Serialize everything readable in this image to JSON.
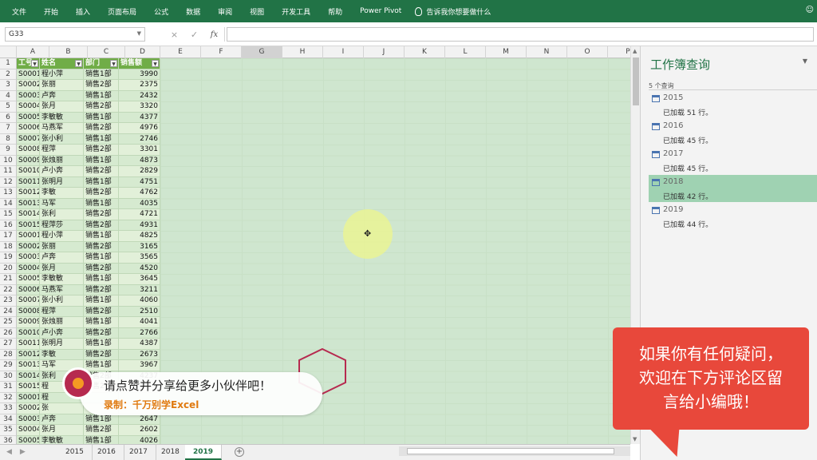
{
  "ribbon": {
    "tabs": [
      "文件",
      "开始",
      "插入",
      "页面布局",
      "公式",
      "数据",
      "审阅",
      "视图",
      "开发工具",
      "帮助",
      "Power Pivot"
    ],
    "tell_me": "告诉我你想要做什么"
  },
  "formula_bar": {
    "name_box": "G33",
    "cancel": "×",
    "enter": "✓",
    "fx": "fx",
    "value": ""
  },
  "columns": [
    "A",
    "B",
    "C",
    "D",
    "E",
    "F",
    "G",
    "H",
    "I",
    "J",
    "K",
    "L",
    "M",
    "N",
    "O",
    "P"
  ],
  "selected_column": "G",
  "table": {
    "headers": [
      "工号",
      "姓名",
      "部门",
      "销售额"
    ],
    "rows": [
      [
        "S0001",
        "程小萍",
        "销售1部",
        "3990"
      ],
      [
        "S0002",
        "张丽",
        "销售2部",
        "2375"
      ],
      [
        "S0003",
        "卢奔",
        "销售1部",
        "2432"
      ],
      [
        "S0004",
        "张月",
        "销售2部",
        "3320"
      ],
      [
        "S0005",
        "李敏敏",
        "销售1部",
        "4377"
      ],
      [
        "S0006",
        "马燕军",
        "销售2部",
        "4976"
      ],
      [
        "S0007",
        "张小利",
        "销售1部",
        "2746"
      ],
      [
        "S0008",
        "程萍",
        "销售2部",
        "3301"
      ],
      [
        "S0009",
        "张烛丽",
        "销售1部",
        "4873"
      ],
      [
        "S0010",
        "卢小奔",
        "销售2部",
        "2829"
      ],
      [
        "S0011",
        "张明月",
        "销售1部",
        "4751"
      ],
      [
        "S0012",
        "李敏",
        "销售2部",
        "4762"
      ],
      [
        "S0013",
        "马军",
        "销售1部",
        "4035"
      ],
      [
        "S0014",
        "张利",
        "销售2部",
        "4721"
      ],
      [
        "S0015",
        "程萍莎",
        "销售2部",
        "4931"
      ],
      [
        "S0001",
        "程小萍",
        "销售1部",
        "4825"
      ],
      [
        "S0002",
        "张丽",
        "销售2部",
        "3165"
      ],
      [
        "S0003",
        "卢奔",
        "销售1部",
        "3565"
      ],
      [
        "S0004",
        "张月",
        "销售2部",
        "4520"
      ],
      [
        "S0005",
        "李敏敏",
        "销售1部",
        "3645"
      ],
      [
        "S0006",
        "马燕军",
        "销售2部",
        "3211"
      ],
      [
        "S0007",
        "张小利",
        "销售1部",
        "4060"
      ],
      [
        "S0008",
        "程萍",
        "销售2部",
        "2510"
      ],
      [
        "S0009",
        "张烛丽",
        "销售1部",
        "4041"
      ],
      [
        "S0010",
        "卢小奔",
        "销售2部",
        "2766"
      ],
      [
        "S0011",
        "张明月",
        "销售1部",
        "4387"
      ],
      [
        "S0012",
        "李敏",
        "销售2部",
        "2673"
      ],
      [
        "S0013",
        "马军",
        "销售1部",
        "3967"
      ],
      [
        "S0014",
        "张利",
        "销售2部",
        "4237"
      ],
      [
        "S0015",
        "程",
        "销售2部",
        ""
      ],
      [
        "S0001",
        "程",
        "",
        ""
      ],
      [
        "S0002",
        "张",
        "",
        ""
      ],
      [
        "S0003",
        "卢奔",
        "销售1部",
        "2647"
      ],
      [
        "S0004",
        "张月",
        "销售2部",
        "2602"
      ],
      [
        "S0005",
        "李敏敏",
        "销售1部",
        "4026"
      ]
    ]
  },
  "sheet_tabs": [
    "2015",
    "2016",
    "2017",
    "2018",
    "2019"
  ],
  "active_sheet": "2019",
  "query_pane": {
    "title": "工作簿查询",
    "count": "5 个查询",
    "queries": [
      {
        "name": "2015",
        "info": "已加载 51 行。"
      },
      {
        "name": "2016",
        "info": "已加载 45 行。"
      },
      {
        "name": "2017",
        "info": "已加载 45 行。"
      },
      {
        "name": "2018",
        "info": "已加载 42 行。"
      },
      {
        "name": "2019",
        "info": "已加载 44 行。"
      }
    ],
    "selected": "2018"
  },
  "banner": {
    "main": "请点赞并分享给更多小伙伴吧！",
    "sub": "录制：千万别学Excel"
  },
  "bubble": {
    "lines": [
      "如果你有任何疑问，",
      "欢迎在下方评论区留",
      "言给小编哦！"
    ]
  },
  "colors": {
    "excel_green": "#217346",
    "table_header": "#70ad47",
    "bubble_red": "#e8483b",
    "query_selected": "#9fd2b2"
  }
}
